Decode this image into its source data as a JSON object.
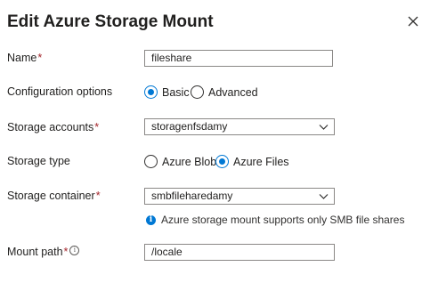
{
  "dialog": {
    "title": "Edit Azure Storage Mount",
    "close_icon": "close-icon"
  },
  "form": {
    "name": {
      "label": "Name",
      "required_mark": "*",
      "value": "fileshare"
    },
    "configuration_options": {
      "label": "Configuration options",
      "options": [
        {
          "label": "Basic",
          "selected": true
        },
        {
          "label": "Advanced",
          "selected": false
        }
      ]
    },
    "storage_accounts": {
      "label": "Storage accounts",
      "required_mark": "*",
      "value": "storagenfsdamy",
      "icon": "chevron-down-icon"
    },
    "storage_type": {
      "label": "Storage type",
      "options": [
        {
          "label": "Azure Blob",
          "selected": false
        },
        {
          "label": "Azure Files",
          "selected": true
        }
      ]
    },
    "storage_container": {
      "label": "Storage container",
      "required_mark": "*",
      "value": "smbfileharedamy",
      "icon": "chevron-down-icon",
      "info_text": "Azure storage mount supports only SMB file shares",
      "info_icon": "info-icon"
    },
    "mount_path": {
      "label": "Mount path",
      "required_mark": "*",
      "tooltip_icon": "info-tooltip-icon",
      "value": "/locale"
    }
  },
  "colors": {
    "accent": "#0078d4",
    "required": "#a4262c",
    "border": "#8a8886"
  }
}
